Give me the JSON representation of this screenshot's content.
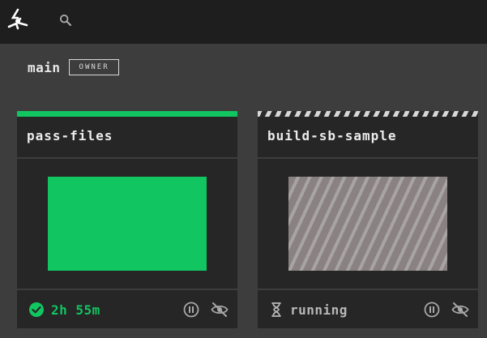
{
  "team": {
    "name": "main",
    "role_badge": "OWNER"
  },
  "colors": {
    "succeeded": "#11c560",
    "running_stripe": "#8a8282",
    "topbar": "#1e1e1e",
    "background": "#3d3d3d"
  },
  "icons": {
    "logo": "concourse-logo-icon",
    "search": "search-icon",
    "pause": "pause-icon",
    "hide": "eye-off-icon",
    "succeeded": "check-circle-icon",
    "running": "hourglass-icon"
  },
  "pipelines": [
    {
      "name": "pass-files",
      "status": "succeeded",
      "status_text": "2h 55m"
    },
    {
      "name": "build-sb-sample",
      "status": "running",
      "status_text": "running"
    }
  ]
}
